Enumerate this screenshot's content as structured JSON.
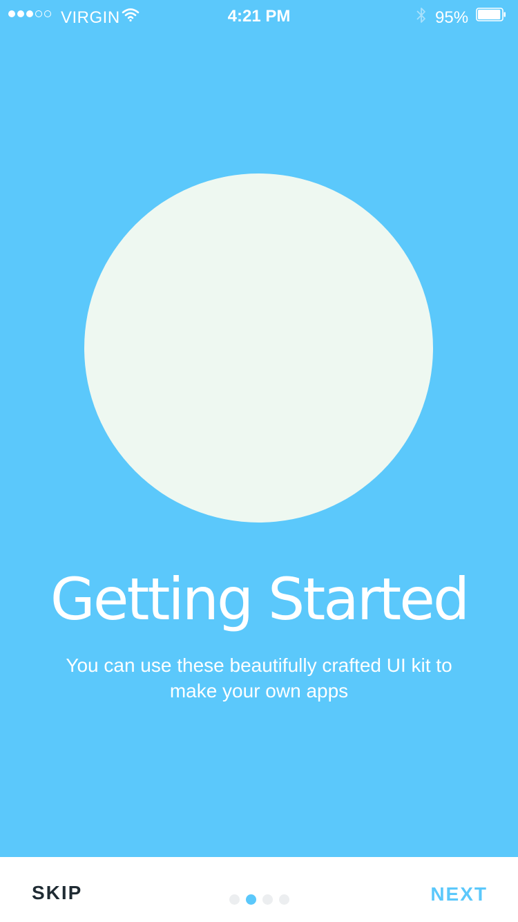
{
  "status_bar": {
    "carrier": "VIRGIN",
    "signal_strength": 3,
    "signal_max": 5,
    "time": "4:21 PM",
    "battery_percent": "95%",
    "battery_level": 0.95,
    "icons": [
      "wifi-icon",
      "bluetooth-icon",
      "battery-icon"
    ]
  },
  "onboarding": {
    "title": "Getting Started",
    "subtitle": "You can use these beautifully crafted UI kit to make your own apps"
  },
  "footer": {
    "skip_label": "SKIP",
    "next_label": "NEXT",
    "page_count": 4,
    "current_page": 2
  },
  "colors": {
    "background": "#5bc8fb",
    "circle": "#eef8f1",
    "accent": "#5bc8fb",
    "skip_text": "#1f2b33",
    "inactive_dot": "#eceef0"
  }
}
